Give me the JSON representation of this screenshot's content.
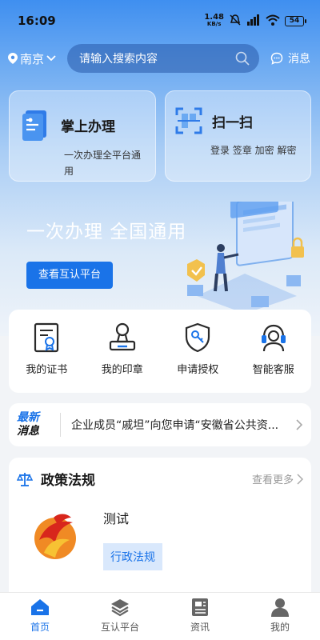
{
  "status_bar": {
    "time": "16:09",
    "net_speed_value": "1.48",
    "net_speed_unit": "KB/s",
    "battery": "54"
  },
  "header": {
    "city": "南京",
    "search_placeholder": "请输入搜索内容",
    "message_label": "消息"
  },
  "cards": [
    {
      "title": "掌上办理",
      "desc": "一次办理全平台通用",
      "icon": "document-icon"
    },
    {
      "title": "扫一扫",
      "desc": "登录 签章 加密 解密",
      "icon": "scan-icon"
    }
  ],
  "banner": {
    "headline": "一次办理 全国通用",
    "button_label": "查看互认平台"
  },
  "quick_actions": [
    {
      "label": "我的证书",
      "icon": "certificate-icon"
    },
    {
      "label": "我的印章",
      "icon": "seal-icon"
    },
    {
      "label": "申请授权",
      "icon": "key-shield-icon"
    },
    {
      "label": "智能客服",
      "icon": "headset-icon"
    }
  ],
  "news": {
    "tag_line1": "最新",
    "tag_line2": "消息",
    "text": "企业成员“戚坦”向您申请“安徽省公共资..."
  },
  "policy": {
    "title": "政策法规",
    "more_label": "查看更多",
    "item_title": "测试",
    "item_category": "行政法规"
  },
  "tabbar": [
    {
      "label": "首页",
      "active": true
    },
    {
      "label": "互认平台",
      "active": false
    },
    {
      "label": "资讯",
      "active": false
    },
    {
      "label": "我的",
      "active": false
    }
  ],
  "colors": {
    "primary": "#1a73e8",
    "header_blue": "#3f8ff0"
  }
}
